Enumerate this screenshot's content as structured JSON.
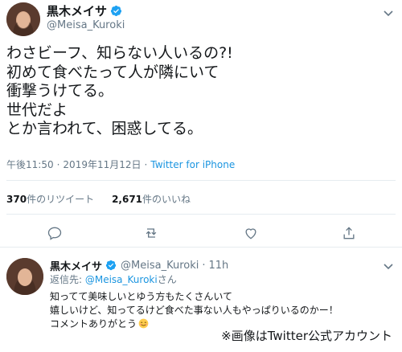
{
  "main_tweet": {
    "display_name": "黒木メイサ",
    "handle": "@Meisa_Kuroki",
    "text_lines": [
      "わさビーフ、知らない人いるの?!",
      "初めて食べたって人が隣にいて",
      "衝撃うけてる。",
      "世代だよ",
      "とか言われて、困惑してる。"
    ],
    "time": "午後11:50",
    "separator": "·",
    "date": "2019年11月12日",
    "source": "Twitter for iPhone",
    "retweets_count": "370",
    "retweets_label": "件のリツイート",
    "likes_count": "2,671",
    "likes_label": "件のいいね"
  },
  "reply_tweet": {
    "display_name": "黒木メイサ",
    "handle": "@Meisa_Kuroki",
    "separator": "·",
    "age": "11h",
    "reply_prefix": "返信先: ",
    "reply_mention": "@Meisa_Kuroki",
    "reply_suffix": "さん",
    "text_lines": [
      "知ってて美味しいとゆう方もたくさんいて",
      "嬉しいけど、知ってるけど食べた事ない人もやっぱりいるのかー！",
      "コメントありがとう"
    ]
  },
  "watermark": "※画像はTwitter公式アカウント",
  "icons": [
    "verified-badge-icon",
    "chevron-down-icon",
    "reply-icon",
    "retweet-icon",
    "like-icon",
    "share-icon",
    "smiling-face-emoji"
  ],
  "colors": {
    "text": "#14171a",
    "secondary": "#657786",
    "link": "#1b95e0",
    "divider": "#e6ecf0",
    "verified": "#1da1f2"
  }
}
